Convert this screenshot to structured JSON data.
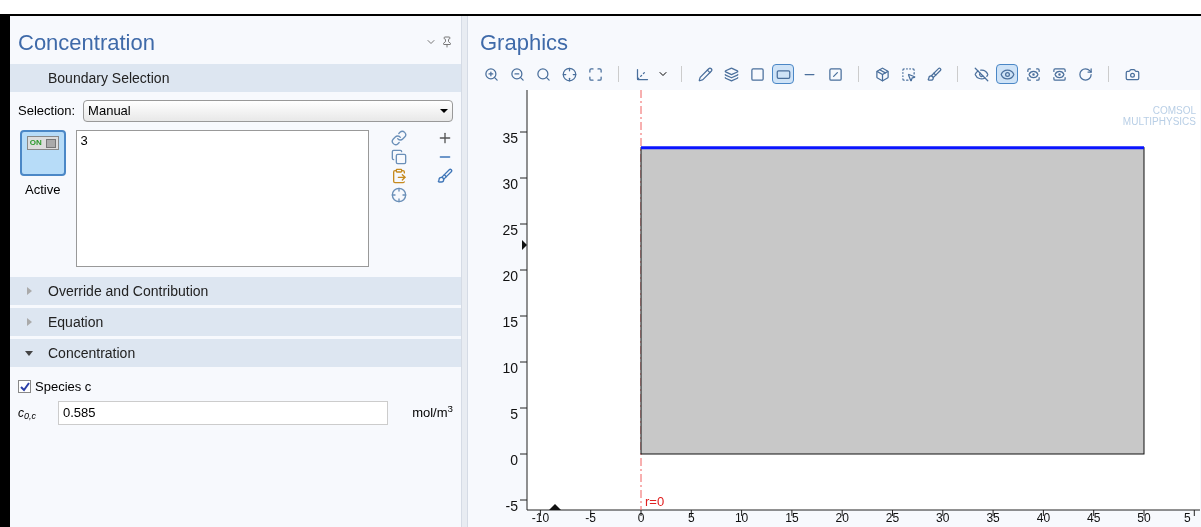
{
  "settings": {
    "title": "Concentration",
    "boundary_header": "Boundary Selection",
    "selection_label": "Selection:",
    "selection_value": "Manual",
    "active_toggle": {
      "badge": "ON",
      "label": "Active",
      "on": true
    },
    "selection_list": [
      "3"
    ],
    "sections": [
      {
        "label": "Override and Contribution",
        "expanded": false
      },
      {
        "label": "Equation",
        "expanded": false
      },
      {
        "label": "Concentration",
        "expanded": true
      }
    ],
    "species": {
      "label": "Species c",
      "checked": true
    },
    "initial": {
      "symbol": "c$_{0,c}$",
      "value": "0.585",
      "unit": "mol/m$^{3}$"
    }
  },
  "graphics": {
    "title": "Graphics",
    "toolbar_groups": [
      [
        {
          "on": false
        },
        {
          "on": false
        },
        {
          "on": false
        },
        {
          "on": false
        },
        {
          "on": false
        }
      ],
      [
        {
          "on": false
        }
      ],
      [
        {
          "on": false
        },
        {
          "on": false
        },
        {
          "on": false
        },
        {
          "on": true
        },
        {
          "on": false
        },
        {
          "on": false
        }
      ],
      [
        {
          "on": false
        },
        {
          "on": false
        },
        {
          "on": false
        }
      ],
      [
        {
          "on": false
        },
        {
          "on": true
        },
        {
          "on": false
        },
        {
          "on": false
        },
        {
          "on": false
        }
      ],
      [
        {
          "on": false
        }
      ]
    ],
    "logo": [
      "COMSOL",
      "MULTIPHYSICS"
    ],
    "y_ticks": [
      "35",
      "30",
      "25",
      "20",
      "15",
      "10",
      "5",
      "0",
      "-5"
    ],
    "x_ticks": [
      "-10",
      "-5",
      "0",
      "5",
      "10",
      "15",
      "20",
      "25",
      "30",
      "35",
      "40",
      "45",
      "50",
      "5"
    ],
    "axis_label": "r=0"
  }
}
